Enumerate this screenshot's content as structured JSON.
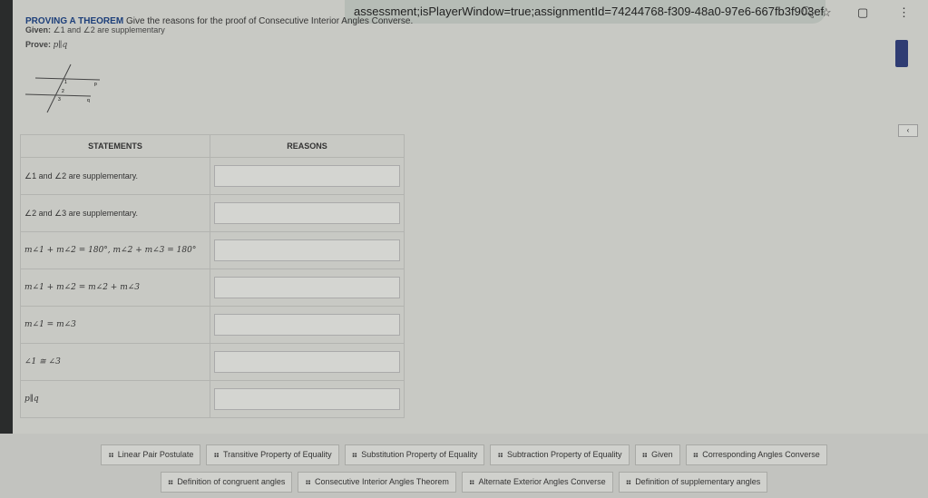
{
  "browser": {
    "url": "assessment;isPlayerWindow=true;assignmentId=74244768-f309-48a0-97e6-667fb3f903ef",
    "icons": [
      "zoom-icon",
      "star-icon",
      "extension-icon",
      "menu-icon"
    ]
  },
  "problem": {
    "heading": "PROVING A THEOREM",
    "instruction": "Give the reasons for the proof of Consecutive Interior Angles Converse.",
    "given_label": "Given:",
    "given_text": "∠1 and ∠2 are supplementary",
    "prove_label": "Prove:",
    "prove_text": "p∥q",
    "diagram_labels": {
      "p": "p",
      "q": "q",
      "a1": "1",
      "a2": "2",
      "a3": "3"
    }
  },
  "table": {
    "headers": [
      "STATEMENTS",
      "REASONS"
    ],
    "rows": [
      {
        "statement": "∠1 and ∠2 are supplementary.",
        "reason": ""
      },
      {
        "statement": "∠2 and ∠3 are supplementary.",
        "reason": ""
      },
      {
        "statement": "m∠1 + m∠2 = 180°, m∠2 + m∠3 = 180°",
        "reason": ""
      },
      {
        "statement": "m∠1 + m∠2 = m∠2 + m∠3",
        "reason": ""
      },
      {
        "statement": "m∠1 = m∠3",
        "reason": ""
      },
      {
        "statement": "∠1 ≅ ∠3",
        "reason": ""
      },
      {
        "statement": "p∥q",
        "reason": ""
      }
    ]
  },
  "bank": {
    "row1": [
      "Linear Pair Postulate",
      "Transitive Property of Equality",
      "Substitution Property of Equality",
      "Subtraction Property of Equality",
      "Given",
      "Corresponding Angles Converse"
    ],
    "row2": [
      "Definition of congruent angles",
      "Consecutive Interior Angles Theorem",
      "Alternate Exterior Angles Converse",
      "Definition of supplementary angles"
    ]
  },
  "colors": {
    "heading": "#1d3f7a",
    "side_panel": "#2f3c73"
  }
}
